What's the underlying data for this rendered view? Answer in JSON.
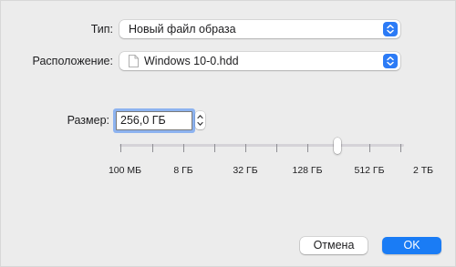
{
  "form": {
    "type_label": "Тип:",
    "type_value": "Новый файл образа",
    "location_label": "Расположение:",
    "location_value": "Windows 10-0.hdd",
    "size_label": "Размер:",
    "size_value": "256,0 ГБ"
  },
  "slider": {
    "tick_labels": [
      "100 МБ",
      "8 ГБ",
      "32 ГБ",
      "128 ГБ",
      "512 ГБ",
      "2 ТБ"
    ],
    "selected_value": "256,0 ГБ"
  },
  "buttons": {
    "cancel_label": "Отмена",
    "ok_label": "OK"
  },
  "colors": {
    "accent": "#1a7cf5",
    "background": "#ececec"
  }
}
